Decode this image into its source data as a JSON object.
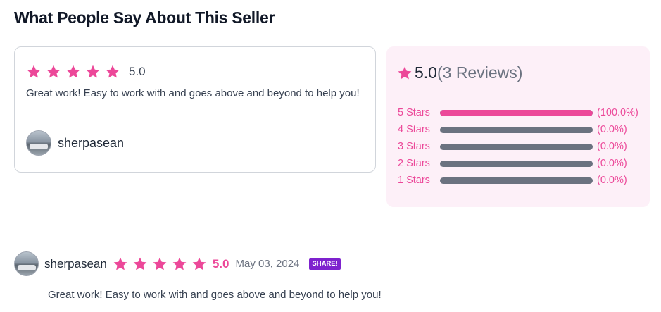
{
  "page": {
    "title": "What People Say About This Seller"
  },
  "review_card": {
    "rating": "5.0",
    "text": "Great work! Easy to work with and goes above and beyond to help you!",
    "username": "sherpasean",
    "stars": 5
  },
  "summary": {
    "average": "5.0",
    "count_label": "(3 Reviews)",
    "bars": [
      {
        "label": "5 Stars",
        "percent_label": "(100.0%)",
        "percent": 100
      },
      {
        "label": "4 Stars",
        "percent_label": "(0.0%)",
        "percent": 0
      },
      {
        "label": "3 Stars",
        "percent_label": "(0.0%)",
        "percent": 0
      },
      {
        "label": "2 Stars",
        "percent_label": "(0.0%)",
        "percent": 0
      },
      {
        "label": "1 Stars",
        "percent_label": "(0.0%)",
        "percent": 0
      }
    ]
  },
  "feed": {
    "username": "sherpasean",
    "rating": "5.0",
    "date": "May 03, 2024",
    "badge": "SHARE!",
    "text": "Great work! Easy to work with and goes above and beyond to help you!"
  },
  "colors": {
    "accent": "#ec4899",
    "badge": "#7e22ce",
    "track": "#6b7280",
    "summary_bg": "#fdf0f8"
  },
  "icons": {
    "star": "star-icon",
    "avatar": "avatar"
  }
}
